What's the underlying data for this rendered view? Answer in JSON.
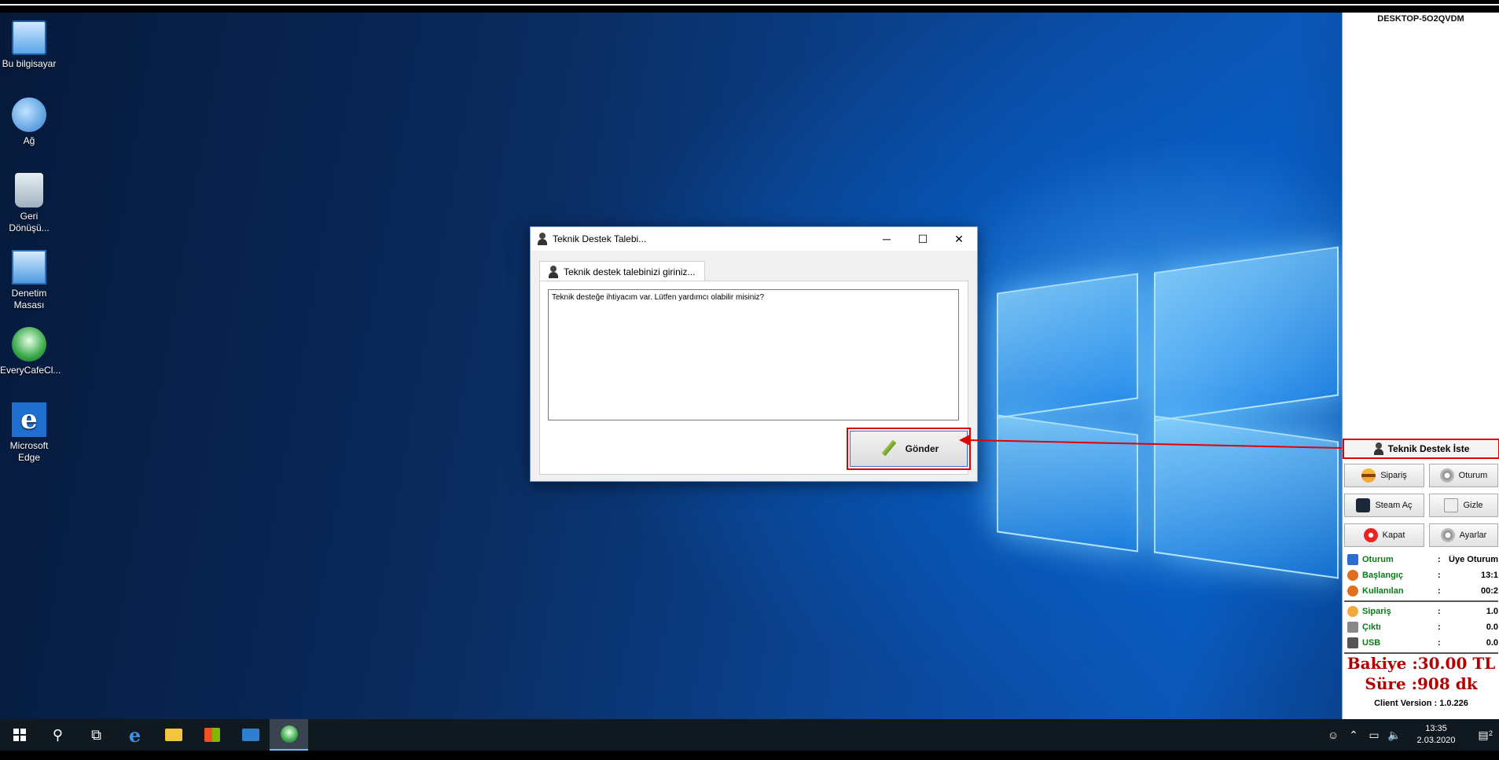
{
  "desktop": {
    "icons": [
      {
        "label": "Bu bilgisayar"
      },
      {
        "label": "Ağ"
      },
      {
        "label": "Geri Dönüşü..."
      },
      {
        "label": "Denetim Masası"
      },
      {
        "label": "EveryCafeCl..."
      },
      {
        "label": "Microsoft Edge"
      }
    ]
  },
  "dialog": {
    "title": "Teknik Destek Talebi...",
    "minimize": "─",
    "maximize": "☐",
    "close": "✕",
    "tab_label": "Teknik destek talebinizi giriniz...",
    "message_value": "Teknik desteğe ihtiyacım var. Lütfen yardımcı olabilir misiniz?",
    "send_label": "Gönder"
  },
  "client_panel": {
    "pc_name": "DESKTOP-5O2QVDM",
    "support_button": "Teknik Destek İste",
    "buttons": [
      {
        "label": "Sipariş",
        "icon": "burger-icon"
      },
      {
        "label": "Oturum",
        "icon": "gear-icon"
      },
      {
        "label": "Steam Aç",
        "icon": "steam-icon"
      },
      {
        "label": "Gizle",
        "icon": "hide-icon"
      },
      {
        "label": "Kapat",
        "icon": "power-icon"
      },
      {
        "label": "Ayarlar",
        "icon": "gear-icon"
      }
    ],
    "session_info": [
      {
        "label": "Oturum",
        "colon": ":",
        "value": "Üye Oturum"
      },
      {
        "label": "Başlangıç",
        "colon": ":",
        "value": "13:1"
      },
      {
        "label": "Kullanılan",
        "colon": ":",
        "value": "00:2"
      }
    ],
    "usage_info": [
      {
        "label": "Sipariş",
        "colon": ":",
        "value": "1.0"
      },
      {
        "label": "Çıktı",
        "colon": ":",
        "value": "0.0"
      },
      {
        "label": "USB",
        "colon": ":",
        "value": "0.0"
      }
    ],
    "balance": "Bakiye :30.00 TL",
    "time_left": "Süre :908 dk",
    "client_version": "Client Version : 1.0.226"
  },
  "taskbar": {
    "time": "13:35",
    "date": "2.03.2020",
    "notification_count": "2"
  },
  "colors": {
    "highlight": "#e00000",
    "label_green": "#0a7a1a",
    "balance_red": "#b00000"
  }
}
